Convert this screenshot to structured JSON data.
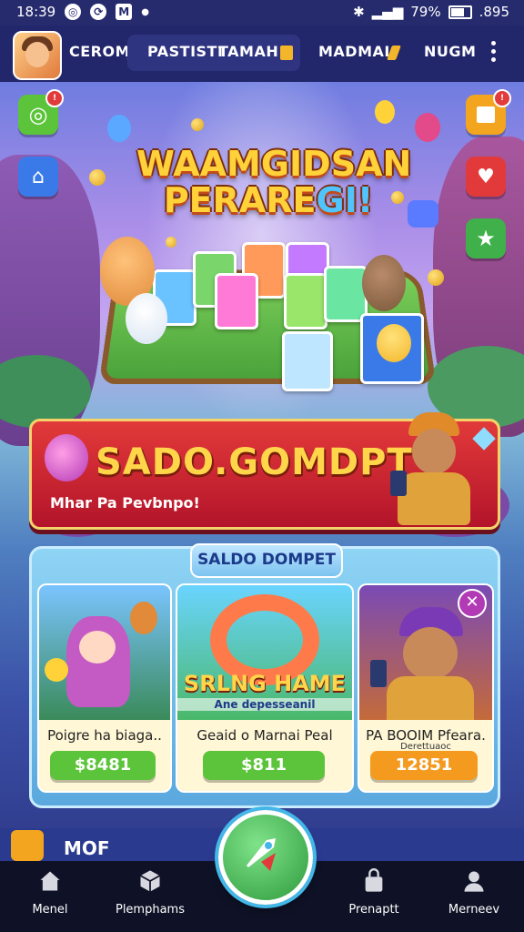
{
  "status_bar": {
    "time": "18:39",
    "battery": "79%",
    "extra": ".895"
  },
  "app_bar": {
    "tabs": [
      "CEROMA",
      "PASTISTI",
      "TAMAH",
      "MADMAI",
      "NUGM"
    ]
  },
  "hero": {
    "title_line1": "WAAMGIDSAN",
    "title_line2": "PERARE",
    "title_line2_accent": "GI!"
  },
  "promo": {
    "title": "SADO.GOMDPT",
    "subtitle": "Mhar Pa Pevbnpo!"
  },
  "wallet_panel": {
    "tab_label": "SALDO DOMPET",
    "cards": [
      {
        "title": "Poigre ha biaga..",
        "price": "$8481",
        "price_color": "#5cc43a"
      },
      {
        "title": "Geaid o Marnai Peal",
        "price": "$811",
        "price_color": "#5cc43a",
        "art_caption": "SRLNG HAME",
        "art_caption2": "Ane depesseanil"
      },
      {
        "title": "PA BOOIM Pfeara.",
        "subtitle": "Derettuaoc",
        "price": "12851",
        "price_color": "#f39a1f"
      }
    ]
  },
  "bottom_strip": {
    "text": "MOF"
  },
  "bottom_nav": {
    "items": [
      {
        "label": "Menel",
        "icon": "home-icon"
      },
      {
        "label": "Plemphams",
        "icon": "cube-icon"
      },
      {
        "label": "Prenaptt",
        "icon": "bag-icon"
      },
      {
        "label": "Merneev",
        "icon": "person-icon"
      }
    ]
  },
  "colors": {
    "status_bar": "#262b6e",
    "app_bar": "#22266a",
    "promo_red": "#e23a3a",
    "title_gold": "#ffd23a",
    "nav_bg": "#0f1226"
  }
}
